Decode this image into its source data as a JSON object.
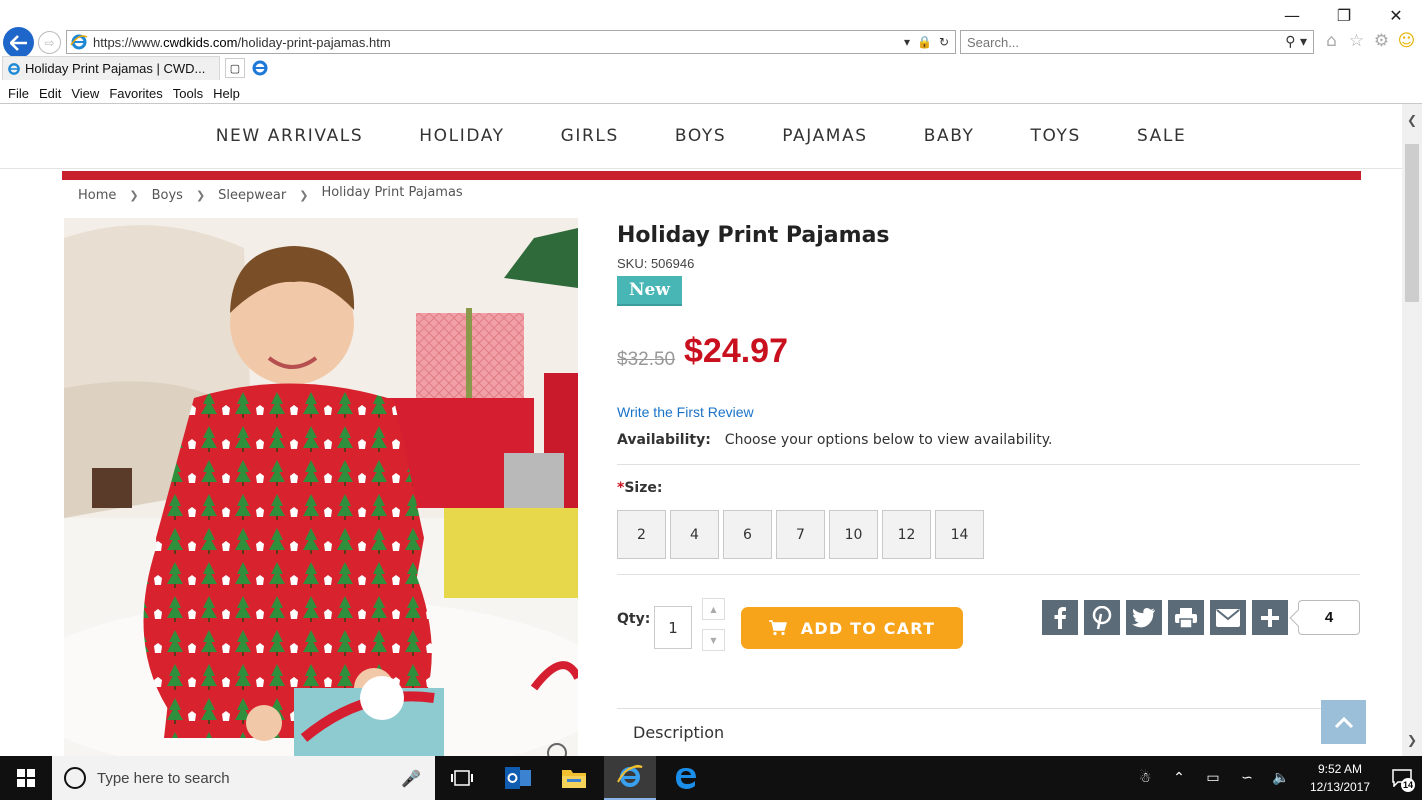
{
  "browser": {
    "address": {
      "prefix": "https://www.",
      "domain": "cwdkids.com",
      "path": "/holiday-print-pajamas.htm"
    },
    "search_placeholder": "Search...",
    "tab_title": "Holiday Print Pajamas | CWD...",
    "menu": [
      "File",
      "Edit",
      "View",
      "Favorites",
      "Tools",
      "Help"
    ]
  },
  "site": {
    "nav": [
      "NEW ARRIVALS",
      "HOLIDAY",
      "GIRLS",
      "BOYS",
      "PAJAMAS",
      "BABY",
      "TOYS",
      "SALE"
    ],
    "accent_color": "#c8202c"
  },
  "breadcrumb": [
    "Home",
    "Boys",
    "Sleepwear",
    "Holiday Print Pajamas"
  ],
  "product": {
    "title": "Holiday Print Pajamas",
    "sku": "SKU: 506946",
    "badge": "New",
    "old_price": "$32.50",
    "price": "$24.97",
    "review_link": "Write the First Review",
    "availability_label": "Availability:",
    "availability_text": "Choose your options below to view availability.",
    "size_required_mark": "*",
    "size_label": "Size:",
    "sizes": [
      "2",
      "4",
      "6",
      "7",
      "10",
      "12",
      "14"
    ],
    "qty_label": "Qty:",
    "qty_value": "1",
    "add_to_cart": "ADD TO CART",
    "share_count": "4",
    "description_tab": "Description"
  },
  "taskbar": {
    "search_placeholder": "Type here to search",
    "time": "9:52 AM",
    "date": "12/13/2017",
    "notifications": "14"
  }
}
